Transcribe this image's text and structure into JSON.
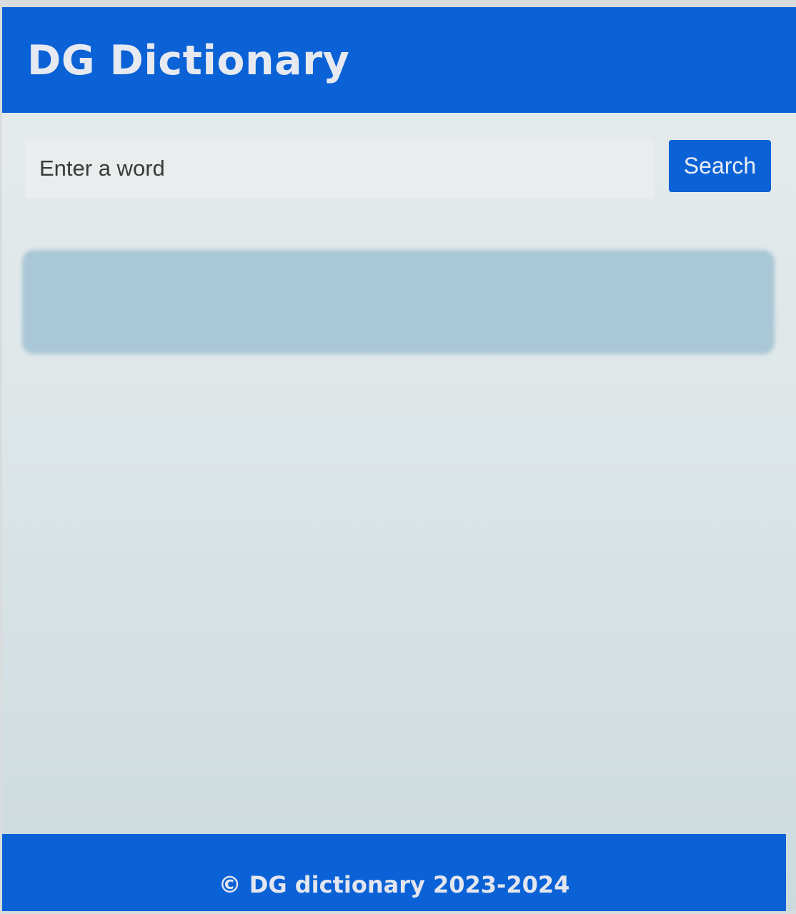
{
  "header": {
    "title": "DG Dictionary"
  },
  "search": {
    "placeholder": "Enter a word",
    "value": "",
    "button_label": "Search"
  },
  "result": {
    "text": ""
  },
  "footer": {
    "copyright": "© DG dictionary 2023-2024"
  },
  "colors": {
    "primary": "#0b62d6",
    "background": "#e3e9ea",
    "result_box": "#a9c7d6"
  }
}
